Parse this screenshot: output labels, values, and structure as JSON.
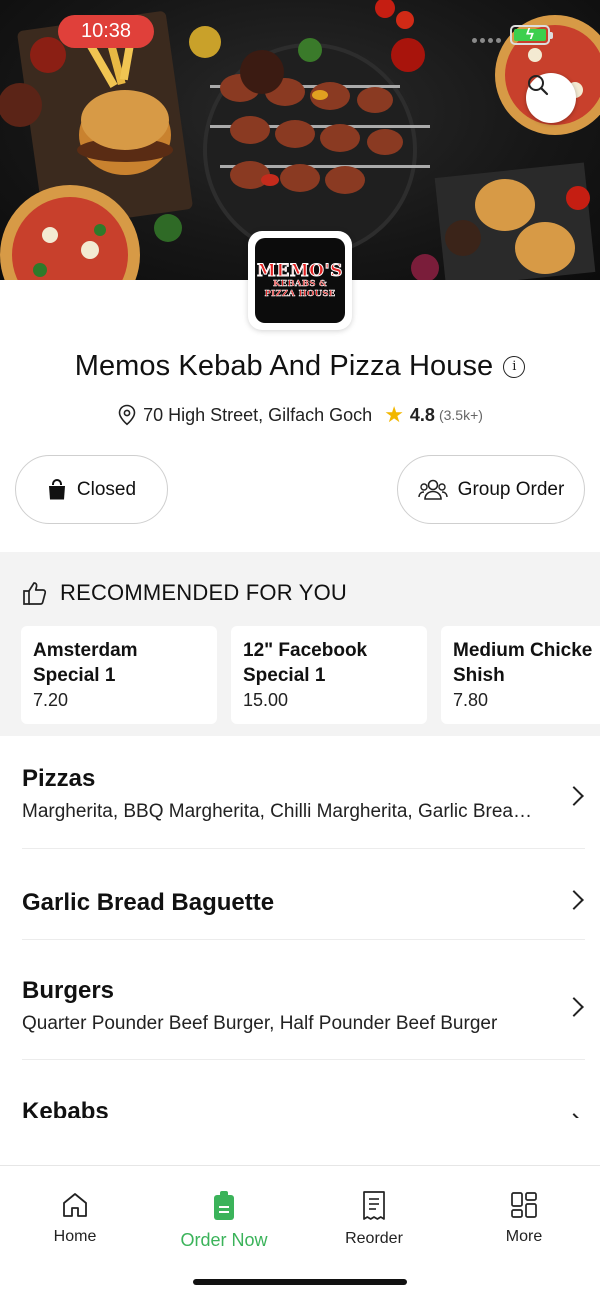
{
  "status_bar": {
    "time": "10:38"
  },
  "hero": {
    "search_icon": "search-icon"
  },
  "logo": {
    "line1": "MEMO'S",
    "line2": "KEBABS &",
    "line3": "PIZZA HOUSE"
  },
  "store": {
    "name": "Memos Kebab And Pizza House",
    "address": "70 High Street, Gilfach Goch",
    "rating": "4.8",
    "rating_count": "(3.5k+)"
  },
  "actions": {
    "closed_label": "Closed",
    "group_order_label": "Group Order"
  },
  "recommended": {
    "title": "RECOMMENDED FOR YOU",
    "items": [
      {
        "name": "Amsterdam\nSpecial 1",
        "price": "7.20"
      },
      {
        "name": "12\" Facebook\nSpecial 1",
        "price": "15.00"
      },
      {
        "name": "Medium Chicke\nShish",
        "price": "7.80"
      }
    ]
  },
  "categories": [
    {
      "name": "Pizzas",
      "desc": "Margherita, BBQ Margherita, Chilli Margherita, Garlic Bread Pizza"
    },
    {
      "name": "Garlic Bread Baguette",
      "desc": ""
    },
    {
      "name": "Burgers",
      "desc": "Quarter Pounder Beef Burger, Half Pounder Beef Burger"
    },
    {
      "name": "Kebabs",
      "desc": ""
    }
  ],
  "tabbar": {
    "home": "Home",
    "order_now": "Order Now",
    "reorder": "Reorder",
    "more": "More"
  },
  "colors": {
    "accent_green": "#3bb35a",
    "time_pill_red": "#e0403a",
    "rating_star": "#f2b700"
  }
}
